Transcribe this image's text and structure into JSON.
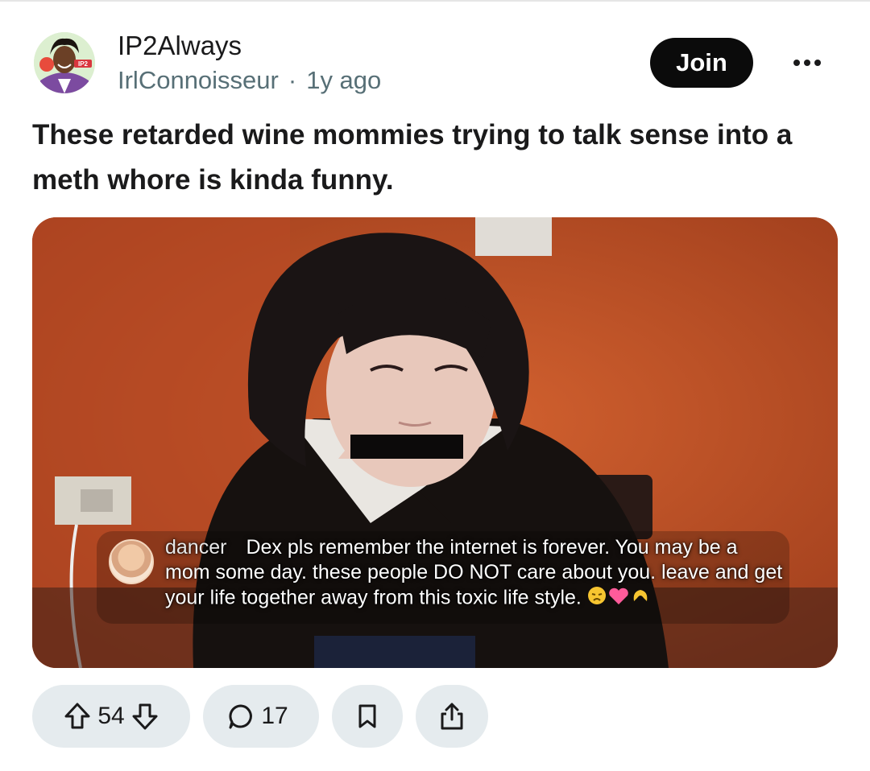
{
  "post": {
    "subreddit": "IP2Always",
    "author": "IrlConnoisseur",
    "separator": "·",
    "age": "1y ago",
    "title": "These retarded wine mommies trying to talk sense into a meth whore is kinda funny.",
    "join_label": "Join",
    "avatar_text": "IP2"
  },
  "media": {
    "overlay": {
      "username": "dancer",
      "message": "Dex pls remember the internet is forever. You may be a mom some day. these people DO NOT care about you. leave and get your life together away from this toxic life style.",
      "emoji_icons": [
        "disappointed-face",
        "pink-heart",
        "heart-hands"
      ]
    }
  },
  "actions": {
    "upvotes": "54",
    "comments": "17"
  },
  "colors": {
    "join_bg": "#0b0b0b",
    "pill_bg": "#e5ebee",
    "meta_text": "#576f76",
    "wall": "#c2552b"
  }
}
